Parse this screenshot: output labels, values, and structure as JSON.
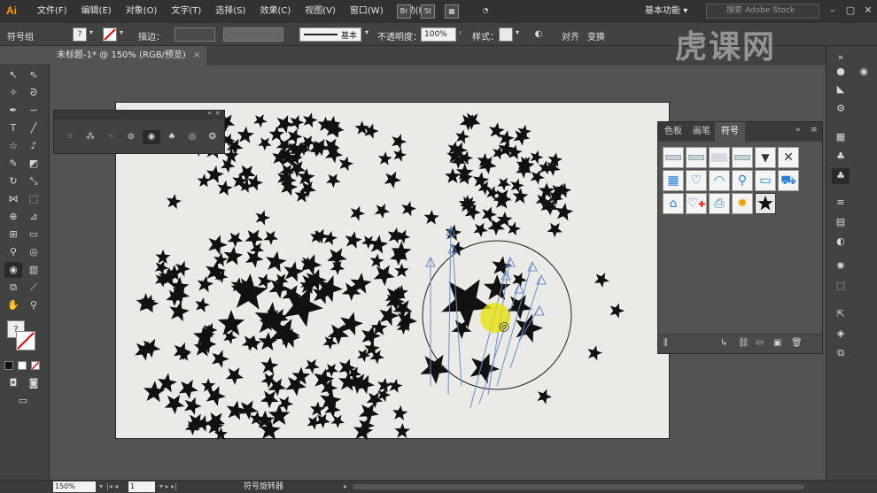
{
  "app": {
    "logo": "Ai"
  },
  "menu": [
    "文件(F)",
    "编辑(E)",
    "对象(O)",
    "文字(T)",
    "选择(S)",
    "效果(C)",
    "视图(V)",
    "窗口(W)",
    "帮助(H)"
  ],
  "menubar": {
    "br_icon": "Br",
    "st_icon": "St",
    "workspace": "基本功能",
    "stock_placeholder": "搜索 Adobe Stock"
  },
  "control": {
    "selection": "符号组",
    "stroke_label": "描边：",
    "stroke_style": "基本",
    "opacity_label": "不透明度：",
    "opacity_value": "100%",
    "style_label": "样式：",
    "align": "对齐",
    "transform": "变换"
  },
  "document": {
    "tab_title": "未标题-1* @ 150% (RGB/预览)",
    "close": "×"
  },
  "symbols_panel": {
    "tabs": [
      "色板",
      "画笔",
      "符号"
    ],
    "active_tab": "符号",
    "symbols": [
      "banner-1",
      "banner-2",
      "banner-3",
      "banner-4",
      "dropdown-arrow",
      "close-x",
      "grid-calendar",
      "heart-plus",
      "rss",
      "search",
      "pipe-bar",
      "cart",
      "home",
      "heart-medical",
      "printer",
      "sunflower",
      "star"
    ]
  },
  "status": {
    "zoom": "150%",
    "page": "1",
    "tool": "符号旋转器"
  },
  "colors": {
    "artboard": "#eaebe6",
    "ui_bg": "#535353",
    "panel": "#424242",
    "accent_yellow": "#e6e000",
    "spin_lines": "#6b8cc7"
  },
  "watermark": "虎课网"
}
